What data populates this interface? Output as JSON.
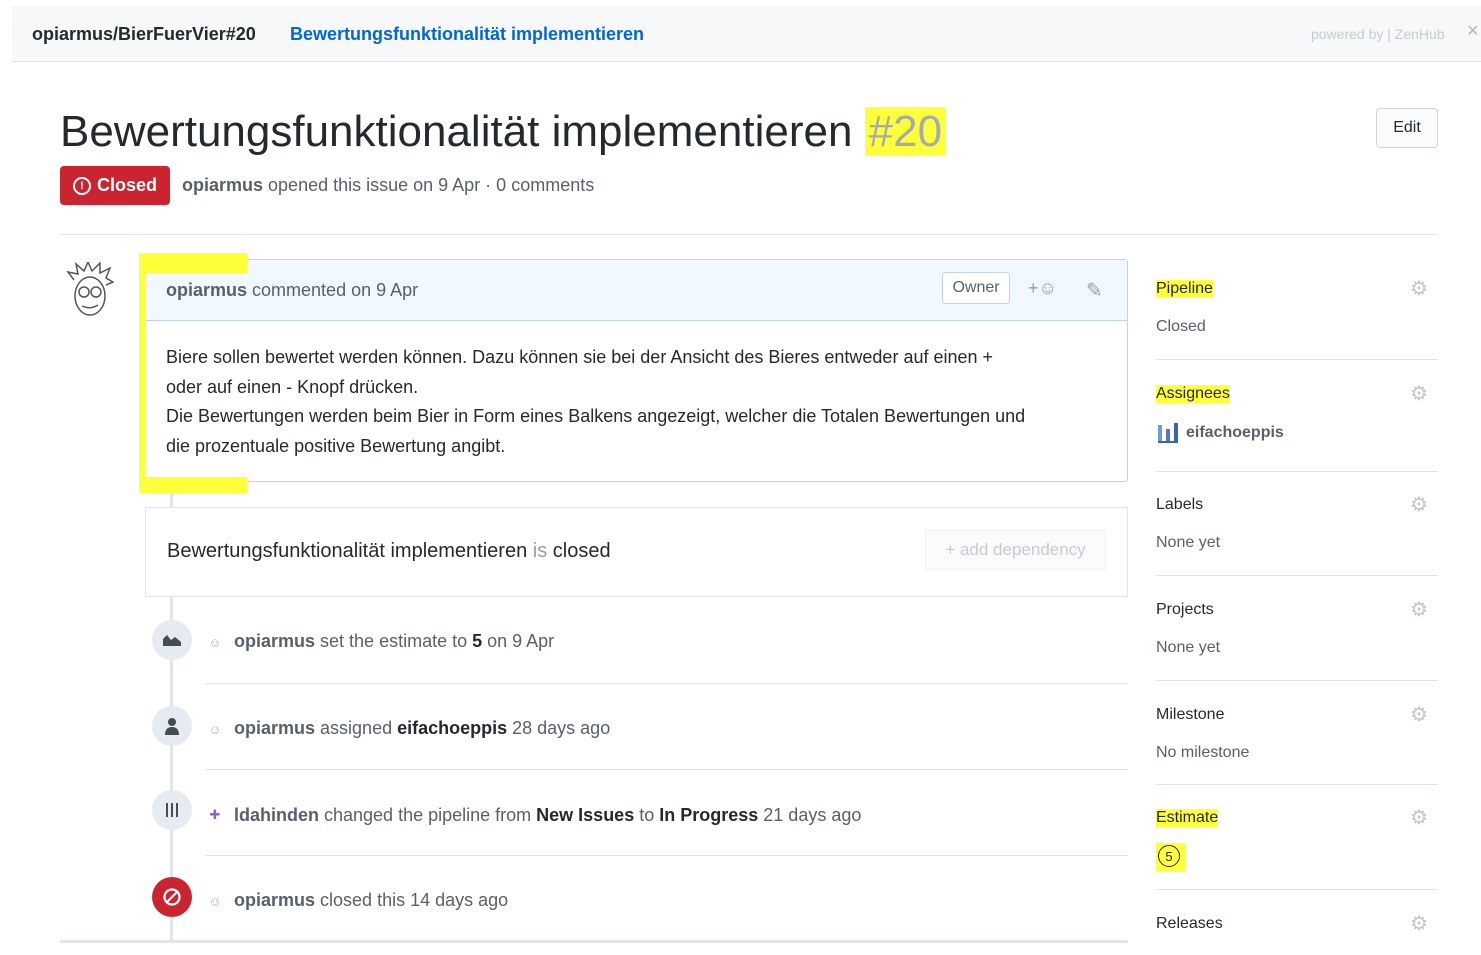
{
  "topbar": {
    "repo_ref": "opiarmus/BierFuerVier#20",
    "issue_link": "Bewertungsfunktionalität implementieren",
    "powered_by": "powered by | ZenHub",
    "close_symbol": "×"
  },
  "issue": {
    "title": "Bewertungsfunktionalität implementieren",
    "number": "#20",
    "edit_label": "Edit",
    "state": "Closed",
    "author": "opiarmus",
    "meta_text": " opened this issue on 9 Apr · 0 comments"
  },
  "comment": {
    "author": "opiarmus",
    "header_text": " commented on 9 Apr",
    "owner_label": "Owner",
    "react_label": "+☺",
    "body_line1": "Biere sollen bewertet werden können. Dazu können sie bei der Ansicht des Bieres entweder auf einen +",
    "body_line2": "oder auf einen - Knopf drücken.",
    "body_line3": "Die Bewertungen werden beim Bier in Form eines Balkens angezeigt, welcher die Totalen Bewertungen und",
    "body_line4": "die prozentuale positive Bewertung angibt."
  },
  "dependency": {
    "issue_title": "Bewertungsfunktionalität implementieren",
    "is_text": " is ",
    "state": "closed",
    "button_label": "+ add dependency"
  },
  "events": [
    {
      "actor": "opiarmus",
      "t1": " set the estimate to ",
      "b1": "5",
      "t2": " on 9 Apr"
    },
    {
      "actor": "opiarmus",
      "t1": " assigned ",
      "b1": "eifachoeppis",
      "t2": " 28 days ago"
    },
    {
      "actor": "ldahinden",
      "t1": " changed the pipeline from ",
      "b1": "New Issues",
      "t2": " to ",
      "b2": "In Progress",
      "t3": " 21 days ago"
    },
    {
      "actor": "opiarmus",
      "t1": " closed this 14 days ago"
    }
  ],
  "sidebar": {
    "pipeline": {
      "label": "Pipeline",
      "value": "Closed"
    },
    "assignees": {
      "label": "Assignees",
      "value": "eifachoeppis"
    },
    "labels": {
      "label": "Labels",
      "value": "None yet"
    },
    "projects": {
      "label": "Projects",
      "value": "None yet"
    },
    "milestone": {
      "label": "Milestone",
      "value": "No milestone"
    },
    "estimate": {
      "label": "Estimate",
      "value": "5"
    },
    "releases": {
      "label": "Releases"
    }
  },
  "colors": {
    "highlight": "#ffff3a",
    "closed_red": "#cb2431",
    "link_blue": "#0366d6"
  },
  "icons": [
    "closed-issue-icon",
    "smiley-icon",
    "pencil-icon",
    "gear-icon",
    "estimate-icon",
    "person-icon",
    "pipeline-icon",
    "ban-icon"
  ]
}
